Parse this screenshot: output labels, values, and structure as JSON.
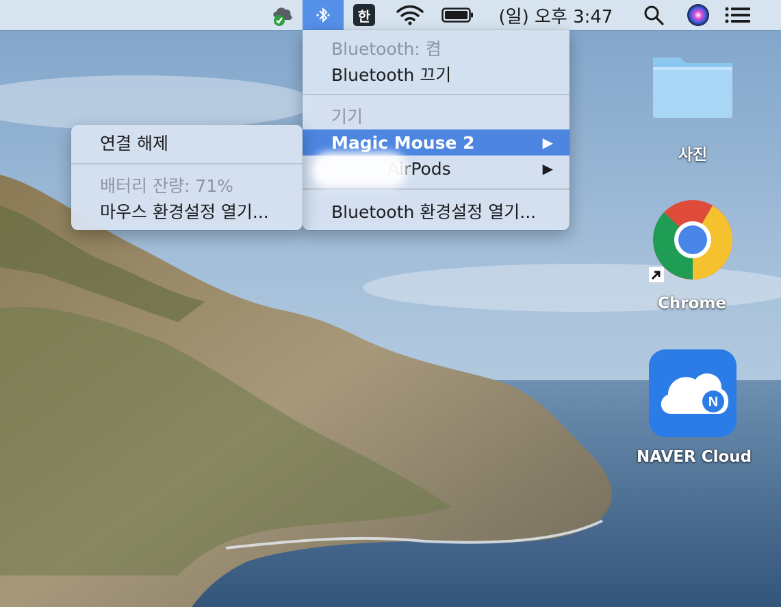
{
  "menubar": {
    "clock": "(일) 오후 3:47",
    "input_source": "한",
    "icons": [
      "icloud-sync-icon",
      "bluetooth-icon",
      "wifi-icon",
      "battery-icon",
      "spotlight-icon",
      "siri-icon",
      "control-center-icon"
    ]
  },
  "bluetooth_menu": {
    "status": "Bluetooth: 켬",
    "toggle": "Bluetooth 끄기",
    "devices_header": "기기",
    "devices": [
      {
        "label": "Magic Mouse 2",
        "arrow": "▶"
      },
      {
        "label": "AirPods",
        "arrow": "▶"
      }
    ],
    "open_prefs": "Bluetooth 환경설정 열기..."
  },
  "device_submenu": {
    "disconnect": "연결 해제",
    "battery": "배터리 잔량: 71%",
    "open_prefs": "마우스 환경설정 열기..."
  },
  "desktop": {
    "items": [
      {
        "label": "사진",
        "icon": "folder-icon"
      },
      {
        "label": "Chrome",
        "icon": "chrome-icon"
      },
      {
        "label": "NAVER Cloud",
        "icon": "naver-cloud-icon"
      }
    ]
  },
  "colors": {
    "accent": "#4d86e0",
    "menu_bg": "#d6e2f0",
    "menubar_bg": "#dee8f3"
  }
}
